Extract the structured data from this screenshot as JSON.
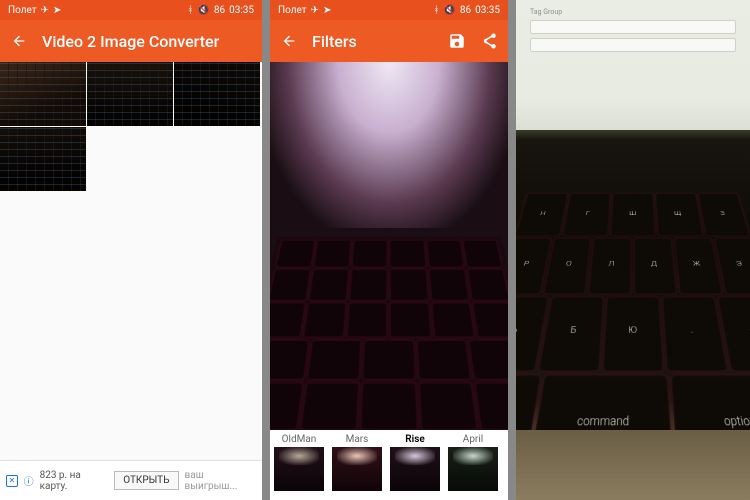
{
  "statusbar": {
    "left_label": "Полет",
    "icons": [
      "airplane-icon",
      "telegram-icon"
    ],
    "right_icons": [
      "bluetooth-icon",
      "silent-icon"
    ],
    "battery": "86",
    "time": "03:35"
  },
  "panel1": {
    "title": "Video 2 Image Converter",
    "ad": {
      "price": "823 р. на карту.",
      "button": "ОТКРЫТЬ",
      "tail": "ваш выигрыш..."
    }
  },
  "panel2": {
    "title": "Filters",
    "filters": [
      {
        "name": "OldMan"
      },
      {
        "name": "Mars"
      },
      {
        "name": "Rise",
        "selected": true
      },
      {
        "name": "April"
      }
    ]
  },
  "panel3": {
    "form_labels": [
      "Tag Group"
    ],
    "visible_keys_row1": [
      "Н",
      "Г",
      "Ш",
      "Щ",
      "З"
    ],
    "visible_keys_row2": [
      "Р",
      "О",
      "Л",
      "Д",
      "Ж",
      "Э"
    ],
    "visible_keys_row3": [
      "Ь",
      "Б",
      "Ю",
      ".",
      "↑"
    ],
    "visible_keys_row4": [
      "⌘",
      "command",
      "option"
    ]
  }
}
